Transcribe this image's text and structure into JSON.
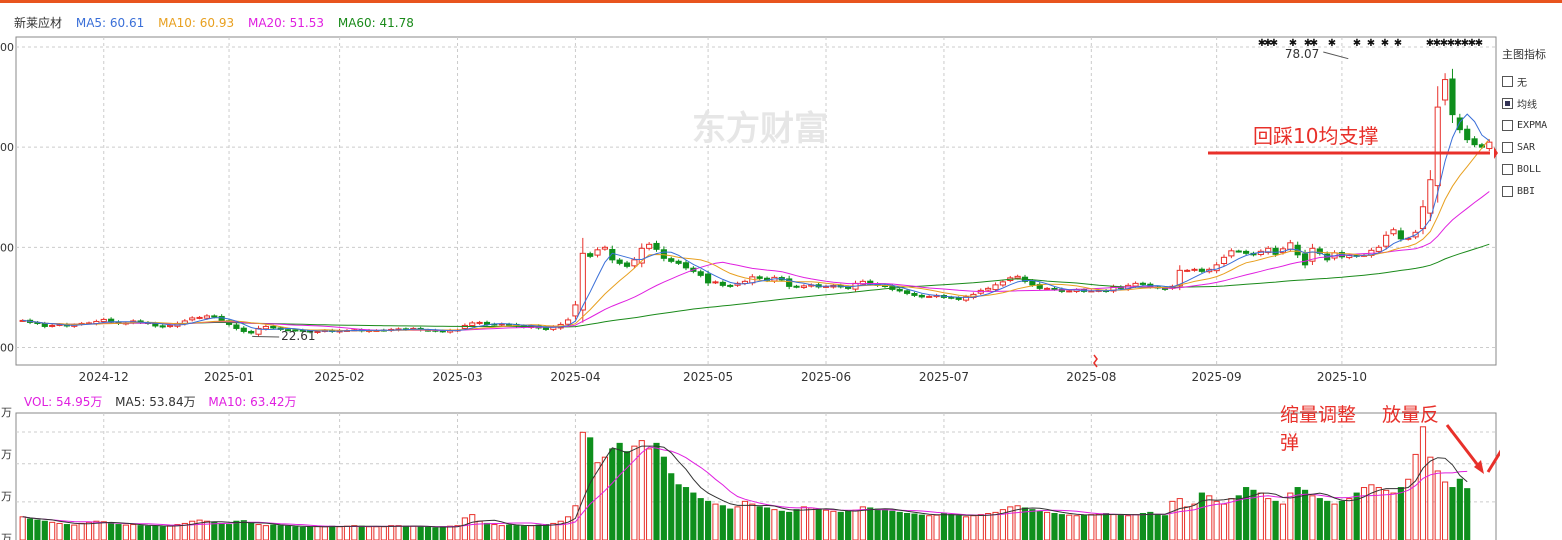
{
  "colors": {
    "top_bar": "#e8541e",
    "up": "#e8302a",
    "down": "#0f8f1d",
    "ma5": "#3a6fd8",
    "ma10": "#e8a020",
    "ma20": "#e020e0",
    "ma60": "#1a8a1a",
    "vol": "#e020e0",
    "vma5": "#333333",
    "grid": "#cccccc",
    "annotation": "#e8302a"
  },
  "legend": {
    "stock": "新莱应材",
    "ma5": "MA5: 60.61",
    "ma10": "MA10: 60.93",
    "ma20": "MA20: 51.53",
    "ma60": "MA60: 41.78"
  },
  "vol_legend": {
    "vol": "VOL: 54.95万",
    "ma5": "MA5: 53.84万",
    "ma10": "MA10: 63.42万"
  },
  "watermark": "东方财富",
  "side_panel": {
    "title": "主图指标",
    "items": [
      {
        "label": "无",
        "checked": false
      },
      {
        "label": "均线",
        "checked": true
      },
      {
        "label": "EXPMA",
        "checked": false
      },
      {
        "label": "SAR",
        "checked": false
      },
      {
        "label": "BOLL",
        "checked": false
      },
      {
        "label": "BBI",
        "checked": false
      }
    ]
  },
  "annotations": {
    "support": "回踩10均支撑",
    "shrink": "缩量调整",
    "rebound": "放量反",
    "rebound2": "弹"
  },
  "marker_glyph": "✱",
  "y_tick_fragments": [
    {
      "v": 80,
      "t": "00"
    },
    {
      "v": 60,
      "t": "00"
    },
    {
      "v": 40,
      "t": "00"
    },
    {
      "v": 20,
      "t": "00"
    }
  ],
  "vol_tick_fragments": [
    "万",
    "万",
    "万",
    "万"
  ],
  "chart_data": {
    "type": "candlestick",
    "x_ticks": [
      "2024-12",
      "2025-01",
      "2025-02",
      "2025-03",
      "2025-04",
      "2025-05",
      "2025-06",
      "2025-07",
      "2025-08",
      "2025-09",
      "2025-10"
    ],
    "x_tick_index": [
      11,
      28,
      43,
      59,
      75,
      93,
      109,
      125,
      145,
      162,
      179
    ],
    "ylim": [
      16.5,
      82
    ],
    "vol_max": 230,
    "high_label": {
      "index": 180,
      "value": "78.07"
    },
    "low_label": {
      "index": 31,
      "value": "22.61"
    },
    "closes": [
      25.4,
      25.0,
      24.8,
      24.2,
      24.4,
      24.6,
      24.3,
      24.5,
      24.8,
      24.9,
      25.2,
      25.6,
      25.1,
      24.8,
      24.9,
      25.3,
      25.0,
      24.8,
      24.3,
      24.1,
      24.4,
      24.8,
      25.3,
      25.9,
      26.0,
      26.3,
      26.1,
      25.4,
      24.6,
      23.8,
      23.2,
      22.9,
      23.8,
      24.2,
      23.9,
      23.6,
      23.5,
      23.4,
      23.3,
      23.1,
      23.2,
      23.4,
      23.2,
      23.4,
      23.4,
      23.5,
      23.3,
      23.4,
      23.4,
      23.4,
      23.6,
      23.7,
      23.6,
      23.8,
      23.5,
      23.4,
      23.3,
      23.2,
      23.4,
      23.5,
      24.4,
      24.9,
      25.0,
      24.6,
      24.6,
      24.7,
      24.6,
      24.3,
      24.1,
      24.3,
      23.9,
      23.6,
      24.1,
      24.6,
      25.5,
      28.5,
      38.8,
      38.2,
      39.5,
      40.0,
      37.5,
      36.8,
      36.2,
      37.5,
      39.8,
      40.6,
      39.6,
      37.8,
      37.2,
      36.8,
      35.9,
      35.2,
      34.4,
      32.9,
      33.1,
      32.4,
      32.2,
      32.8,
      33.2,
      34.1,
      33.8,
      33.4,
      34.0,
      33.5,
      32.2,
      32.1,
      32.3,
      32.5,
      32.1,
      32.2,
      32.4,
      32.1,
      31.8,
      32.8,
      33.2,
      32.7,
      32.4,
      32.2,
      31.6,
      31.3,
      30.8,
      30.4,
      30.1,
      30.2,
      30.4,
      30.0,
      29.9,
      29.6,
      30.1,
      30.6,
      31.4,
      31.8,
      32.5,
      33.1,
      33.9,
      34.2,
      33.2,
      32.5,
      31.8,
      31.8,
      31.6,
      31.2,
      31.3,
      31.5,
      31.2,
      31.3,
      31.4,
      31.2,
      32.1,
      31.8,
      32.4,
      32.8,
      32.6,
      32.1,
      31.9,
      31.6,
      32.2,
      35.4,
      35.4,
      35.6,
      35.2,
      35.6,
      36.5,
      38.0,
      39.3,
      39.2,
      38.8,
      38.5,
      39.2,
      39.8,
      38.6,
      39.7,
      40.9,
      38.5,
      36.5,
      39.8,
      38.8,
      37.5,
      38.9,
      38.1,
      38.4,
      38.2,
      38.4,
      39.4,
      40.0,
      42.4,
      43.5,
      41.7,
      41.8,
      43.0,
      48.1,
      53.5,
      68.0,
      73.5,
      66.5,
      63.5,
      61.5,
      60.5,
      60.0,
      61.0
    ],
    "volumes": [
      42,
      38,
      36,
      34,
      32,
      30,
      28,
      27,
      30,
      32,
      34,
      33,
      30,
      28,
      27,
      28,
      26,
      25,
      25,
      24,
      26,
      28,
      30,
      34,
      36,
      34,
      32,
      30,
      28,
      34,
      35,
      30,
      28,
      26,
      27,
      26,
      25,
      24,
      23,
      24,
      25,
      24,
      25,
      24,
      25,
      26,
      25,
      24,
      24,
      24,
      26,
      26,
      25,
      25,
      24,
      23,
      22,
      24,
      25,
      26,
      40,
      46,
      34,
      30,
      28,
      26,
      27,
      26,
      25,
      26,
      27,
      28,
      30,
      34,
      42,
      62,
      195,
      185,
      140,
      150,
      165,
      175,
      160,
      170,
      180,
      165,
      175,
      150,
      120,
      100,
      95,
      85,
      75,
      70,
      65,
      62,
      56,
      60,
      70,
      65,
      60,
      58,
      55,
      52,
      50,
      55,
      60,
      58,
      56,
      54,
      52,
      50,
      52,
      54,
      60,
      58,
      56,
      55,
      52,
      50,
      48,
      47,
      45,
      44,
      45,
      48,
      46,
      44,
      42,
      44,
      46,
      48,
      50,
      55,
      60,
      62,
      58,
      55,
      52,
      50,
      48,
      46,
      45,
      44,
      45,
      46,
      47,
      48,
      46,
      45,
      44,
      46,
      48,
      50,
      46,
      44,
      70,
      75,
      60,
      65,
      85,
      80,
      70,
      65,
      75,
      80,
      95,
      90,
      85,
      75,
      70,
      65,
      85,
      95,
      90,
      80,
      75,
      70,
      65,
      70,
      75,
      85,
      95,
      100,
      95,
      90,
      85,
      95,
      110,
      155,
      205,
      150,
      125,
      105,
      95,
      110,
      93
    ]
  }
}
